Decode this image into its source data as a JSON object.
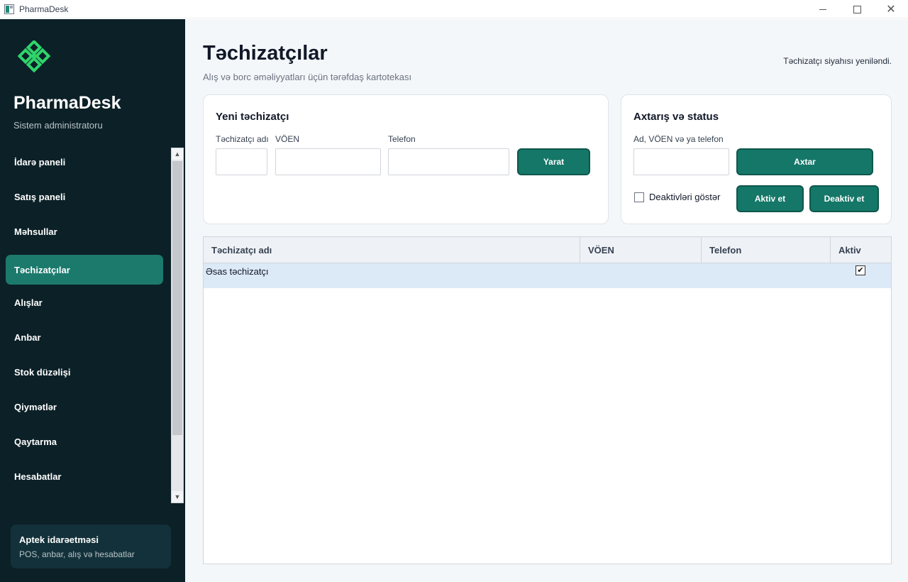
{
  "window": {
    "title": "PharmaDesk"
  },
  "sidebar": {
    "brand": "PharmaDesk",
    "role": "Sistem administratoru",
    "items": [
      {
        "label": "İdarə paneli"
      },
      {
        "label": "Satış paneli"
      },
      {
        "label": "Məhsullar"
      },
      {
        "label": "Təchizatçılar",
        "active": true
      },
      {
        "label": "Alışlar"
      },
      {
        "label": "Anbar"
      },
      {
        "label": "Stok düzəlişi"
      },
      {
        "label": "Qiymətlər"
      },
      {
        "label": "Qaytarma"
      },
      {
        "label": "Hesabatlar"
      }
    ],
    "info": {
      "title": "Aptek idarəetməsi",
      "subtitle": "POS, anbar, alış və hesabatlar"
    }
  },
  "header": {
    "title": "Təchizatçılar",
    "subtitle": "Alış və borc əməliyyatları üçün tərəfdaş kartotekası",
    "status": "Təchizatçı siyahısı yeniləndi."
  },
  "new_supplier": {
    "title": "Yeni təchizatçı",
    "name_label": "Təchizatçı adı",
    "tax_label": "VÖEN",
    "phone_label": "Telefon",
    "name_value": "",
    "tax_value": "",
    "phone_value": "",
    "create_button": "Yarat"
  },
  "search": {
    "title": "Axtarış və status",
    "query_label": "Ad, VÖEN və ya telefon",
    "query_value": "",
    "search_button": "Axtar",
    "show_inactive_label": "Deaktivləri göstər",
    "show_inactive_checked": false,
    "activate_button": "Aktiv et",
    "deactivate_button": "Deaktiv et"
  },
  "table": {
    "columns": [
      "Təchizatçı adı",
      "VÖEN",
      "Telefon",
      "Aktiv"
    ],
    "rows": [
      {
        "name": "Əsas təchizatçı",
        "tax": "",
        "phone": "",
        "active": true
      }
    ]
  },
  "colors": {
    "sidebar_bg": "#0c2027",
    "accent": "#157768",
    "nav_active": "#1c7a6d",
    "logo": "#2fd46b",
    "row_selected": "#dce9f7"
  },
  "icons": [
    "app-icon",
    "logo-icon",
    "minimize-icon",
    "maximize-icon",
    "close-icon",
    "check-icon"
  ]
}
